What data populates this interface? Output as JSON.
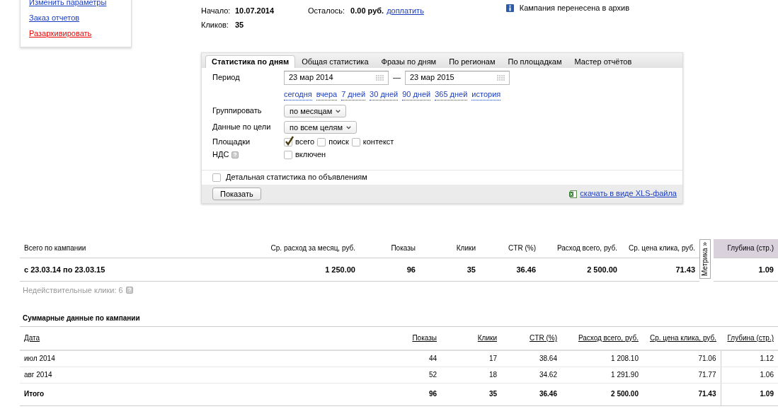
{
  "sidebar": {
    "links": [
      {
        "label": "Изменить параметры",
        "kind": "link"
      },
      {
        "label": "Заказ отчетов",
        "kind": "link"
      },
      {
        "label": "Разархивировать",
        "kind": "danger"
      }
    ]
  },
  "info": {
    "start_label": "Начало:",
    "start_value": "10.07.2014",
    "left_label": "Осталось:",
    "left_value": "0.00 руб.",
    "topup_link": "доплатить",
    "clicks_label": "Кликов:",
    "clicks_value": "35"
  },
  "archive_note": "Кампания перенесена в архив",
  "panel": {
    "tabs": [
      {
        "label": "Статистика по дням",
        "selected": true
      },
      {
        "label": "Общая статистика",
        "selected": false
      },
      {
        "label": "Фразы по дням",
        "selected": false
      },
      {
        "label": "По регионам",
        "selected": false
      },
      {
        "label": "По площадкам",
        "selected": false
      },
      {
        "label": "Мастер отчётов",
        "selected": false
      }
    ],
    "period": {
      "label": "Период",
      "from": "23 мар 2014",
      "separator": "—",
      "to": "23 мар 2015"
    },
    "quick_ranges": [
      "сегодня",
      "вчера",
      "7 дней",
      "30 дней",
      "90 дней",
      "365 дней",
      "история"
    ],
    "group": {
      "label": "Группировать",
      "value": "по месяцам"
    },
    "goal": {
      "label": "Данные по цели",
      "value": "по всем целям"
    },
    "platforms": {
      "label": "Площадки",
      "options": [
        {
          "label": "всего",
          "checked": true
        },
        {
          "label": "поиск",
          "checked": false
        },
        {
          "label": "контекст",
          "checked": false
        }
      ]
    },
    "vat": {
      "label": "НДС",
      "option": {
        "label": "включен",
        "checked": false
      }
    },
    "detailed": {
      "label": "Детальная статистика по объявлениям",
      "checked": false
    },
    "show_button": "Показать",
    "xls_link": "скачать в виде XLS-файла"
  },
  "summary": {
    "columns": [
      "Всего по кампании",
      "Ср. расход за месяц, руб.",
      "Показы",
      "Клики",
      "CTR (%)",
      "Расход всего, руб.",
      "Ср. цена клика, руб.",
      "Глубина (стр.)"
    ],
    "metrika_tab": "Метрика »",
    "rows": [
      {
        "cells": [
          "с 23.03.14 по 23.03.15",
          "1 250.00",
          "96",
          "35",
          "36.46",
          "2 500.00",
          "71.43",
          "1.09"
        ]
      }
    ],
    "invalid_clicks": "Недействительные клики: 6"
  },
  "monthly": {
    "title": "Суммарные данные по кампании",
    "columns": [
      "Дата",
      "Показы",
      "Клики",
      "CTR (%)",
      "Расход всего, руб.",
      "Ср. цена клика, руб.",
      "Глубина (стр.)"
    ],
    "rows": [
      {
        "kind": "month",
        "cells": [
          "июл 2014",
          "44",
          "17",
          "38.64",
          "1 208.10",
          "71.06",
          "1.12"
        ]
      },
      {
        "kind": "month",
        "cells": [
          "авг 2014",
          "52",
          "18",
          "34.62",
          "1 291.90",
          "71.77",
          "1.06"
        ]
      },
      {
        "kind": "total",
        "cells": [
          "Итого",
          "96",
          "35",
          "36.46",
          "2 500.00",
          "71.43",
          "1.09"
        ]
      }
    ]
  }
}
